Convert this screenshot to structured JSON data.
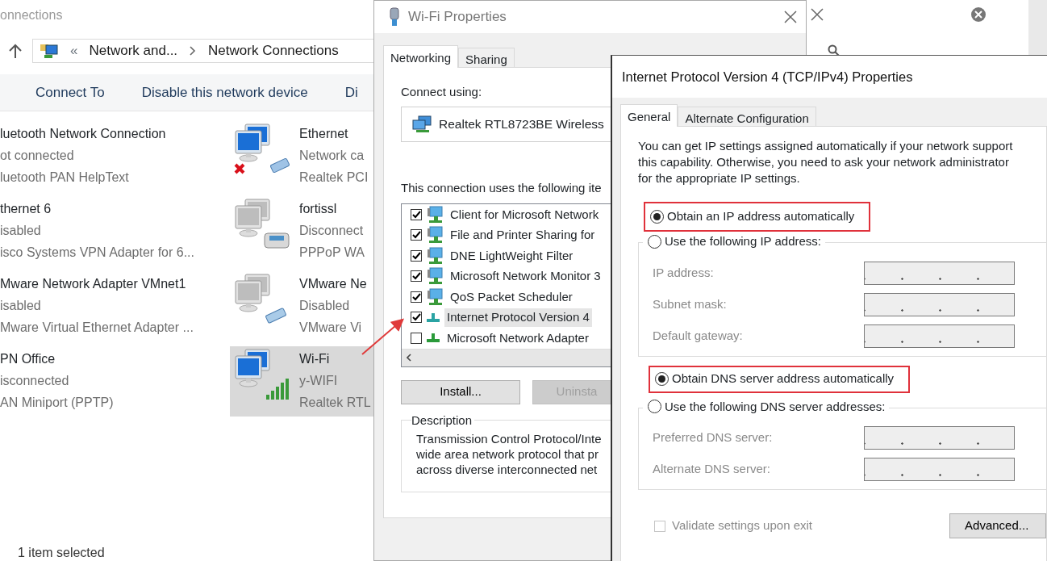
{
  "explorer": {
    "title": "onnections",
    "overflow": "«",
    "breadcrumb": [
      {
        "label": "Network and..."
      },
      {
        "label": "Network Connections"
      }
    ],
    "commands": [
      "Connect To",
      "Disable this network device",
      "Di"
    ],
    "columns": [
      {
        "items": [
          {
            "name": "luetooth Network Connection",
            "status": "ot connected",
            "device": "luetooth PAN HelpText",
            "selected": false
          },
          {
            "name": "thernet 6",
            "status": "isabled",
            "device": "isco Systems VPN Adapter for 6...",
            "selected": false
          },
          {
            "name": "Mware Network Adapter VMnet1",
            "status": "isabled",
            "device": "Mware Virtual Ethernet Adapter ...",
            "selected": false
          },
          {
            "name": "PN Office",
            "status": "isconnected",
            "device": "AN Miniport (PPTP)",
            "selected": false
          }
        ]
      },
      {
        "items": [
          {
            "name": "Ethernet",
            "status": "Network ca",
            "device": "Realtek PCI",
            "selected": false,
            "kind": "unplugged"
          },
          {
            "name": "fortissl",
            "status": "Disconnect",
            "device": "PPPoP WA",
            "selected": false,
            "kind": "dialup"
          },
          {
            "name": "VMware Ne",
            "status": "Disabled",
            "device": "VMware Vi",
            "selected": false,
            "kind": "disabled"
          },
          {
            "name": "Wi-Fi",
            "status": "y-WIFI",
            "device": "Realtek RTL",
            "selected": true,
            "kind": "wifi"
          }
        ]
      }
    ],
    "status_bar": "1 item selected"
  },
  "wifi_properties": {
    "title": "Wi-Fi Properties",
    "tabs": [
      {
        "label": "Networking",
        "selected": true
      },
      {
        "label": "Sharing",
        "selected": false
      }
    ],
    "connect_using": "Connect using:",
    "adapter": "Realtek RTL8723BE Wireless",
    "items_label": "This connection uses the following ite",
    "components": [
      {
        "label": "Client for Microsoft Network",
        "checked": true,
        "selected": false,
        "kind": "service"
      },
      {
        "label": "File and Printer Sharing for",
        "checked": true,
        "selected": false,
        "kind": "service"
      },
      {
        "label": "DNE LightWeight Filter",
        "checked": true,
        "selected": false,
        "kind": "service"
      },
      {
        "label": "Microsoft Network Monitor 3",
        "checked": true,
        "selected": false,
        "kind": "service"
      },
      {
        "label": "QoS Packet Scheduler",
        "checked": true,
        "selected": false,
        "kind": "service"
      },
      {
        "label": "Internet Protocol Version 4",
        "checked": true,
        "selected": true,
        "kind": "protocol"
      },
      {
        "label": "Microsoft Network Adapter",
        "checked": false,
        "selected": false,
        "kind": "protocol"
      }
    ],
    "buttons": [
      {
        "label": "Install...",
        "disabled": false
      },
      {
        "label": "Uninsta",
        "disabled": true
      }
    ],
    "description_label": "Description",
    "description": [
      "Transmission Control Protocol/Inte",
      "wide area network protocol that pr",
      "across diverse interconnected net"
    ]
  },
  "ipv4_properties": {
    "title": "Internet Protocol Version 4 (TCP/IPv4) Properties",
    "tabs": [
      {
        "label": "General",
        "selected": true
      },
      {
        "label": "Alternate Configuration",
        "selected": false
      }
    ],
    "intro": [
      "You can get IP settings assigned automatically if your network support",
      "this capability. Otherwise, you need to ask your network administrator",
      "for the appropriate IP settings."
    ],
    "ip_options": [
      {
        "label": "Obtain an IP address automatically",
        "selected": true,
        "highlighted": true
      },
      {
        "label": "Use the following IP address:",
        "selected": false,
        "highlighted": false
      }
    ],
    "ip_fields": [
      {
        "label": "IP address:"
      },
      {
        "label": "Subnet mask:"
      },
      {
        "label": "Default gateway:"
      }
    ],
    "dns_options": [
      {
        "label": "Obtain DNS server address automatically",
        "selected": true,
        "highlighted": true
      },
      {
        "label": "Use the following DNS server addresses:",
        "selected": false,
        "highlighted": false
      }
    ],
    "dns_fields": [
      {
        "label": "Preferred DNS server:"
      },
      {
        "label": "Alternate DNS server:"
      }
    ],
    "validate": {
      "label": "Validate settings upon exit",
      "checked": false,
      "disabled": true
    },
    "advanced_button": "Advanced..."
  }
}
